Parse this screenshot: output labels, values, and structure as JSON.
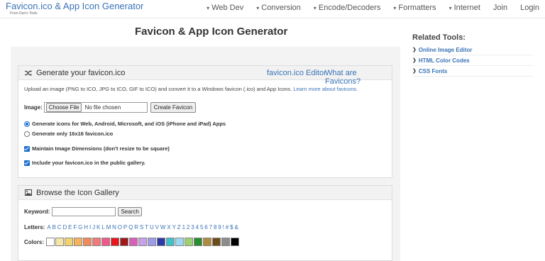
{
  "site": {
    "title": "Favicon.ico & App Icon Generator",
    "subtitle": "From Dan's Tools"
  },
  "nav": [
    {
      "label": "Web Dev",
      "caret": true
    },
    {
      "label": "Conversion",
      "caret": true
    },
    {
      "label": "Encode/Decoders",
      "caret": true
    },
    {
      "label": "Formatters",
      "caret": true
    },
    {
      "label": "Internet",
      "caret": false
    },
    {
      "label": "Join",
      "caret": false
    },
    {
      "label": "Login",
      "caret": false
    }
  ],
  "page_title": "Favicon & App Icon Generator",
  "generate": {
    "title": "Generate your favicon.ico",
    "editor_link": "favicon.ico Editor",
    "what_link": "What are Favicons?",
    "description": "Upload an image (PNG to ICO, JPG to ICO, GIF to ICO) and convert it to a Windows favicon (.ico) and App Icons.",
    "learn_more": "Learn more about favicons.",
    "image_label": "Image:",
    "choose_file": "Choose File",
    "file_status": "No file chosen",
    "create_button": "Create Favicon",
    "option_all": "Generate icons for Web, Android, Microsoft, and iOS (iPhone and iPad) Apps",
    "option_16": "Generate only 16x16 favicon.ico",
    "maintain_dims": "Maintain Image Dimensions (don't resize to be square)",
    "include_gallery": "Include your favicon.ico in the public gallery."
  },
  "gallery": {
    "title": "Browse the Icon Gallery",
    "keyword_label": "Keyword:",
    "search_button": "Search",
    "letters_label": "Letters:",
    "letters": [
      "A",
      "B",
      "C",
      "D",
      "E",
      "F",
      "G",
      "H",
      "I",
      "J",
      "K",
      "L",
      "M",
      "N",
      "O",
      "P",
      "Q",
      "R",
      "S",
      "T",
      "U",
      "V",
      "W",
      "X",
      "Y",
      "Z",
      "1",
      "2",
      "3",
      "4",
      "5",
      "6",
      "7",
      "8",
      "9",
      "!",
      "#",
      "$",
      "&"
    ],
    "colors_label": "Colors:",
    "colors": [
      "#ffffff",
      "#f5e6a8",
      "#f4d36b",
      "#f6b35c",
      "#f08a5a",
      "#f07a7a",
      "#f05a8a",
      "#e8141e",
      "#a01818",
      "#d860b8",
      "#c8a0e8",
      "#9c9ce8",
      "#2c3aa8",
      "#40c0c8",
      "#9cd8f0",
      "#9cd070",
      "#2c8c30",
      "#b08c40",
      "#6c4c18",
      "#8c8c8c",
      "#000000"
    ]
  },
  "related": {
    "title": "Related Tools:",
    "items": [
      "Online Image Editor",
      "HTML Color Codes",
      "CSS Fonts"
    ]
  }
}
